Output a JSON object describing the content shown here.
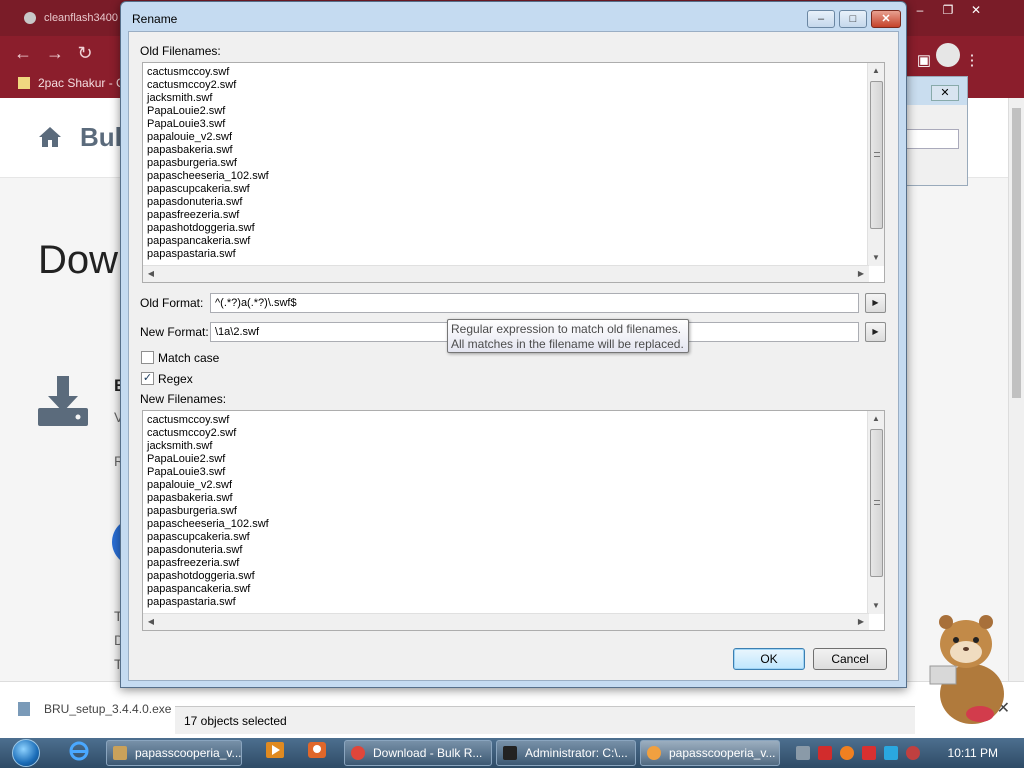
{
  "chrome": {
    "tab_title": "cleanflash3400",
    "bookmark": "2pac Shakur - C",
    "brand": "Bul",
    "page_title": "Dow",
    "fragments": [
      "B",
      "V",
      "R",
      "T",
      "D",
      "T"
    ]
  },
  "downloads": {
    "file": "BRU_setup_3.4.4.0.exe"
  },
  "dialog": {
    "title": "Rename",
    "old_filenames_label": "Old Filenames:",
    "old_filenames": [
      "cactusmccoy.swf",
      "cactusmccoy2.swf",
      "jacksmith.swf",
      "PapaLouie2.swf",
      "PapaLouie3.swf",
      "papalouie_v2.swf",
      "papasbakeria.swf",
      "papasburgeria.swf",
      "papascheeseria_102.swf",
      "papascupcakeria.swf",
      "papasdonuteria.swf",
      "papasfreezeria.swf",
      "papashotdoggeria.swf",
      "papaspancakeria.swf",
      "papaspastaria.swf"
    ],
    "old_format_label": "Old Format:",
    "old_format_value": "^(.*?)a(.*?)\\.swf$",
    "new_format_label": "New Format:",
    "new_format_value": "\\1a\\2.swf",
    "match_case_label": "Match case",
    "match_case_checked": false,
    "regex_label": "Regex",
    "regex_checked": true,
    "new_filenames_label": "New Filenames:",
    "new_filenames": [
      "cactusmccoy.swf",
      "cactusmccoy2.swf",
      "jacksmith.swf",
      "PapaLouie2.swf",
      "PapaLouie3.swf",
      "papalouie_v2.swf",
      "papasbakeria.swf",
      "papasburgeria.swf",
      "papascheeseria_102.swf",
      "papascupcakeria.swf",
      "papasdonuteria.swf",
      "papasfreezeria.swf",
      "papashotdoggeria.swf",
      "papaspancakeria.swf",
      "papaspastaria.swf"
    ],
    "tooltip_line1": "Regular expression to match old filenames.",
    "tooltip_line2": "All matches in the filename will be replaced.",
    "ok_label": "OK",
    "cancel_label": "Cancel"
  },
  "status": {
    "selected": "17 objects selected"
  },
  "taskbar": {
    "items": [
      {
        "label": "papasscooperia_v...",
        "color": "#c9a15a"
      },
      {
        "label": "Download - Bulk R...",
        "color": "#e0463a"
      },
      {
        "label": "Administrator: C:\\...",
        "color": "#222222"
      },
      {
        "label": "papasscooperia_v...",
        "color": "#f0a040"
      }
    ],
    "clock": "10:11 PM"
  },
  "colors": {
    "browser_chrome": "#8b1e2c",
    "dialog_frame": "#c5dbf1",
    "taskbar": "#3d5d7b"
  },
  "icons": [
    "home-icon",
    "download-icon",
    "back-icon",
    "forward-icon",
    "reload-icon",
    "ie-icon",
    "media-player-icon",
    "people-icon"
  ]
}
